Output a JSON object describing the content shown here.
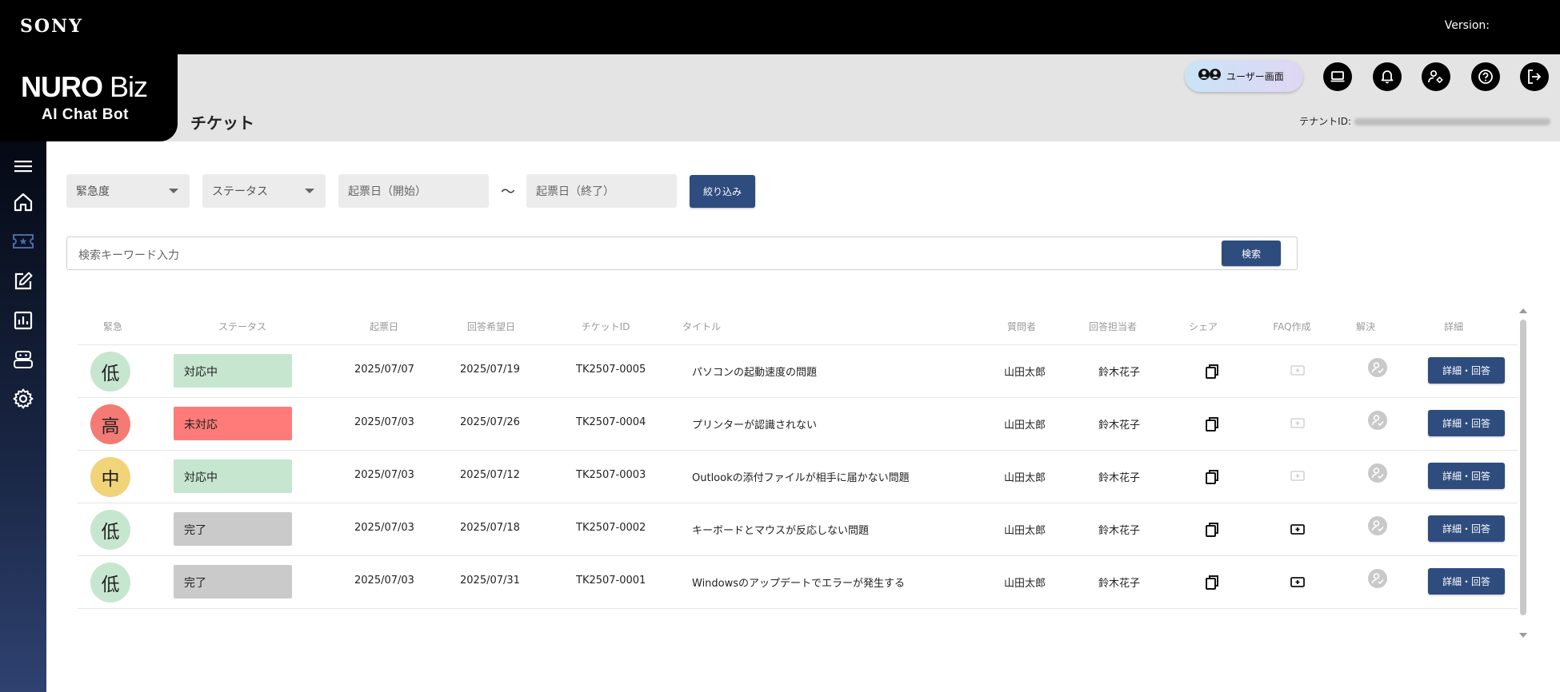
{
  "topbar": {
    "brand": "SONY",
    "version_label": "Version:"
  },
  "brand": {
    "name_bold": "NURO",
    "name_light": " Biz",
    "subtitle": "AI Chat Bot"
  },
  "header": {
    "page_title": "チケット",
    "user_screen_label": "ユーザー画面",
    "tenant_label": "テナントID:",
    "icons": [
      "monitor-icon",
      "bell-icon",
      "user-settings-icon",
      "help-icon",
      "logout-icon"
    ]
  },
  "sidebar": {
    "icons": [
      "menu-icon",
      "home-icon",
      "ticket-icon",
      "edit-icon",
      "analytics-icon",
      "bot-icon",
      "settings-icon"
    ],
    "active": "ticket-icon"
  },
  "filters": {
    "urgency_placeholder": "緊急度",
    "status_placeholder": "ステータス",
    "date_start_placeholder": "起票日（開始）",
    "tilde": "〜",
    "date_end_placeholder": "起票日（終了）",
    "filter_button": "絞り込み",
    "search_placeholder": "検索キーワード入力",
    "search_button": "検索"
  },
  "table": {
    "headers": {
      "urgency": "緊急",
      "status": "ステータス",
      "created": "起票日",
      "due": "回答希望日",
      "ticket_id": "チケットID",
      "title": "タイトル",
      "asker": "質問者",
      "assignee": "回答担当者",
      "share": "シェア",
      "faq": "FAQ作成",
      "resolved": "解決",
      "detail": "詳細"
    },
    "rows": [
      {
        "urgency": "低",
        "status": "対応中",
        "created": "2025/07/07",
        "due": "2025/07/19",
        "ticket_id": "TK2507-0005",
        "title": "パソコンの起動速度の問題",
        "asker": "山田太郎",
        "assignee": "鈴木花子",
        "faq_enabled": false,
        "detail_button": "詳細・回答"
      },
      {
        "urgency": "高",
        "status": "未対応",
        "created": "2025/07/03",
        "due": "2025/07/26",
        "ticket_id": "TK2507-0004",
        "title": "プリンターが認識されない",
        "asker": "山田太郎",
        "assignee": "鈴木花子",
        "faq_enabled": false,
        "detail_button": "詳細・回答"
      },
      {
        "urgency": "中",
        "status": "対応中",
        "created": "2025/07/03",
        "due": "2025/07/12",
        "ticket_id": "TK2507-0003",
        "title": "Outlookの添付ファイルが相手に届かない問題",
        "asker": "山田太郎",
        "assignee": "鈴木花子",
        "faq_enabled": false,
        "detail_button": "詳細・回答"
      },
      {
        "urgency": "低",
        "status": "完了",
        "created": "2025/07/03",
        "due": "2025/07/18",
        "ticket_id": "TK2507-0002",
        "title": "キーボードとマウスが反応しない問題",
        "asker": "山田太郎",
        "assignee": "鈴木花子",
        "faq_enabled": true,
        "detail_button": "詳細・回答"
      },
      {
        "urgency": "低",
        "status": "完了",
        "created": "2025/07/03",
        "due": "2025/07/31",
        "ticket_id": "TK2507-0001",
        "title": "Windowsのアップデートでエラーが発生する",
        "asker": "山田太郎",
        "assignee": "鈴木花子",
        "faq_enabled": true,
        "detail_button": "詳細・回答"
      }
    ]
  },
  "colors": {
    "urgency_low": "#c6e6d0",
    "urgency_high": "#f47a74",
    "urgency_mid": "#f1d378",
    "status_in_progress": "#c6e6d0",
    "status_open": "#ff7b79",
    "status_done": "#cacaca",
    "navy": "#2f4c7e"
  }
}
